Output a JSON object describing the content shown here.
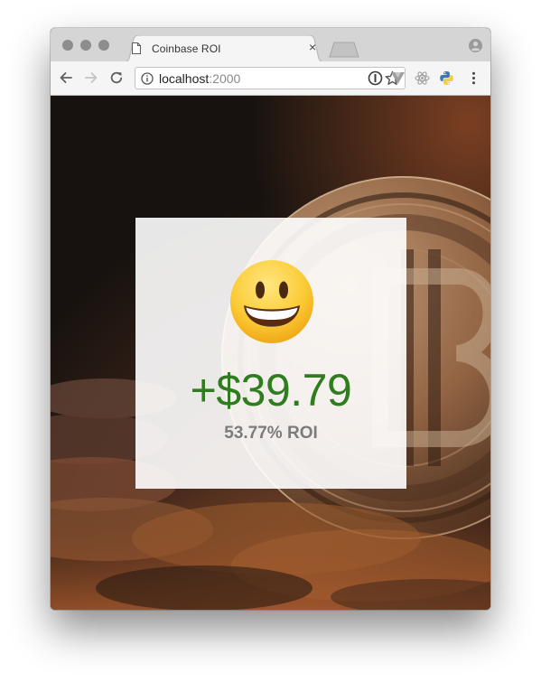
{
  "browser": {
    "tab": {
      "title": "Coinbase ROI",
      "close_label": "×",
      "icon": "document-icon"
    },
    "address": {
      "host": "localhost",
      "port": ":2000"
    },
    "icons": [
      "back-arrow-icon",
      "forward-arrow-icon",
      "reload-icon",
      "info-icon",
      "star-icon",
      "password-extension-icon",
      "vue-devtools-icon",
      "react-devtools-icon",
      "python-extension-icon",
      "menu-dots-icon",
      "profile-icon"
    ]
  },
  "page": {
    "emoji": "grinning-face-icon",
    "gain_text": "+$39.79",
    "roi_text": "53.77% ROI",
    "colors": {
      "gain": "#2f7d1f",
      "roi": "#7b7b7b",
      "card": "#ffffff"
    }
  }
}
